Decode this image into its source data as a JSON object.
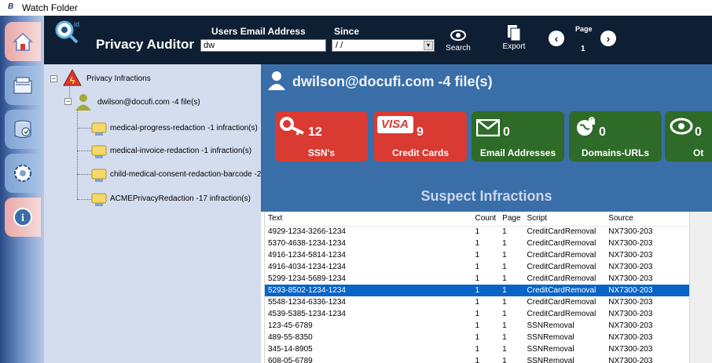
{
  "window": {
    "title": "Watch Folder",
    "icon_text": "B"
  },
  "rail": {
    "items": [
      {
        "name": "home",
        "icon": "home-icon"
      },
      {
        "name": "folders",
        "icon": "folders-icon"
      },
      {
        "name": "database",
        "icon": "database-icon"
      },
      {
        "name": "settings",
        "icon": "gear-icon"
      },
      {
        "name": "info",
        "icon": "info-icon"
      }
    ]
  },
  "header": {
    "app_title": "Privacy Auditor",
    "logo_text": "id",
    "email_label": "Users Email Address",
    "email_value": "dw",
    "since_label": "Since",
    "since_value": "/ /",
    "search_label": "Search",
    "export_label": "Export",
    "page_label": "Page",
    "page_number": "1"
  },
  "tree": {
    "root": "Privacy Infractions",
    "user": "dwilson@docufi.com -4 file(s)",
    "files": [
      "medical-progress-redaction -1 infraction(s)",
      "medical-invoice-redaction -1 infraction(s)",
      "child-medical-consent-redaction-barcode -2",
      "ACMEPrivacyRedaction -17 infraction(s)"
    ]
  },
  "main": {
    "user_header": "dwilson@docufi.com -4 file(s)",
    "tiles": [
      {
        "count": "12",
        "label": "SSN's",
        "color": "#d93a32",
        "icon": "key-icon"
      },
      {
        "count": "9",
        "label": "Credit Cards",
        "color": "#d93a32",
        "icon": "visa-icon",
        "icon_text": "VISA"
      },
      {
        "count": "0",
        "label": "Email Addresses",
        "color": "#2e6b28",
        "icon": "envelope-icon"
      },
      {
        "count": "0",
        "label": "Domains-URLs",
        "color": "#2e6b28",
        "icon": "globe-lock-icon"
      },
      {
        "count": "0",
        "label": "Ot",
        "color": "#2e6b28",
        "icon": "eye-icon"
      }
    ],
    "suspect_title": "Suspect Infractions",
    "grid": {
      "columns": [
        "Text",
        "Count",
        "Page",
        "Script",
        "Source"
      ],
      "rows": [
        [
          "4929-1234-3266-1234",
          "1",
          "1",
          "CreditCardRemoval",
          "NX7300-203"
        ],
        [
          "5370-4638-1234-1234",
          "1",
          "1",
          "CreditCardRemoval",
          "NX7300-203"
        ],
        [
          "4916-1234-5814-1234",
          "1",
          "1",
          "CreditCardRemoval",
          "NX7300-203"
        ],
        [
          "4916-4034-1234-1234",
          "1",
          "1",
          "CreditCardRemoval",
          "NX7300-203"
        ],
        [
          "5299-1234-5689-1234",
          "1",
          "1",
          "CreditCardRemoval",
          "NX7300-203"
        ],
        [
          "5293-8502-1234-1234",
          "1",
          "1",
          "CreditCardRemoval",
          "NX7300-203"
        ],
        [
          "5548-1234-6336-1234",
          "1",
          "1",
          "CreditCardRemoval",
          "NX7300-203"
        ],
        [
          "4539-5385-1234-1234",
          "1",
          "1",
          "CreditCardRemoval",
          "NX7300-203"
        ],
        [
          "123-45-6789",
          "1",
          "1",
          "SSNRemoval",
          "NX7300-203"
        ],
        [
          "489-55-8350",
          "1",
          "1",
          "SSNRemoval",
          "NX7300-203"
        ],
        [
          "345-14-8905",
          "1",
          "1",
          "SSNRemoval",
          "NX7300-203"
        ],
        [
          "608-05-6789",
          "1",
          "1",
          "SSNRemoval",
          "NX7300-203"
        ]
      ],
      "selected_row": 5
    }
  }
}
